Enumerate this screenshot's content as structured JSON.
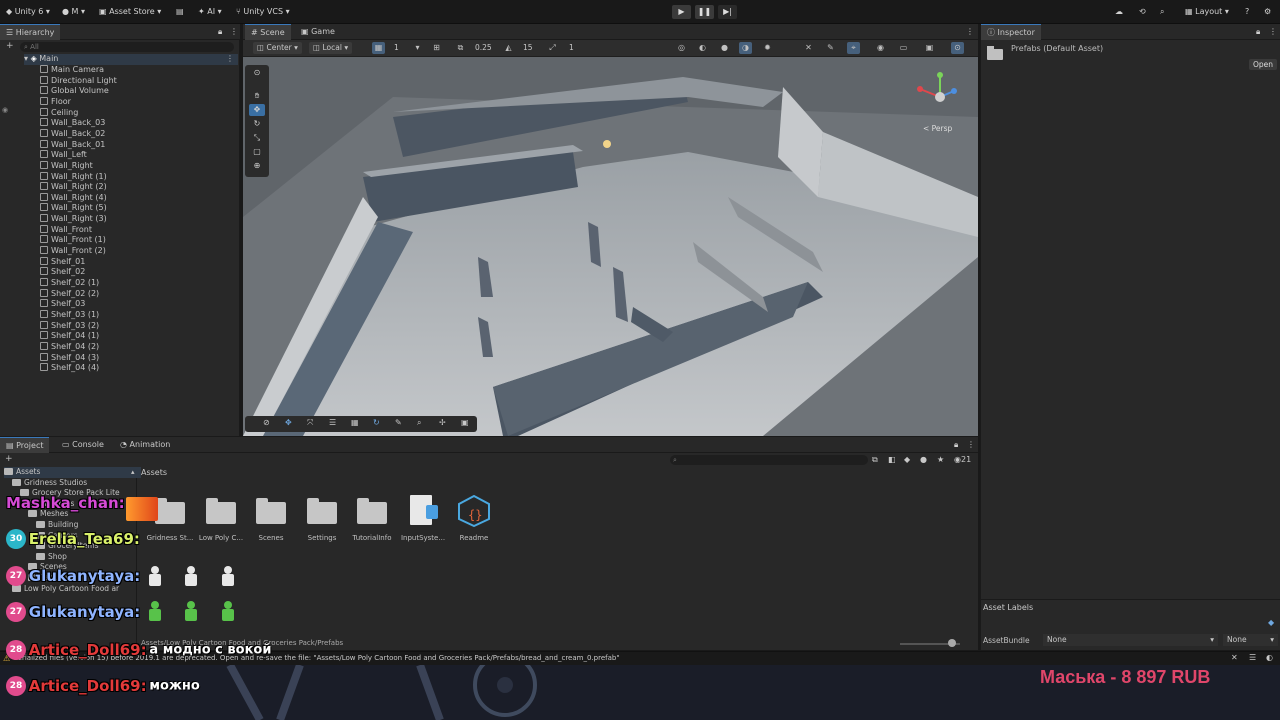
{
  "toolbar": {
    "account": "Unity 6",
    "user": "M",
    "asset_store": "Asset Store",
    "ai": "AI",
    "vcs": "Unity VCS",
    "layout": "Layout"
  },
  "hierarchy": {
    "tab": "Hierarchy",
    "search_placeholder": "All",
    "scene": "Main",
    "items": [
      "Main Camera",
      "Directional Light",
      "Global Volume",
      "Floor",
      "Ceiling",
      "Wall_Back_03",
      "Wall_Back_02",
      "Wall_Back_01",
      "Wall_Left",
      "Wall_Right",
      "Wall_Right (1)",
      "Wall_Right (2)",
      "Wall_Right (4)",
      "Wall_Right (5)",
      "Wall_Right (3)",
      "Wall_Front",
      "Wall_Front (1)",
      "Wall_Front (2)",
      "Shelf_01",
      "Shelf_02",
      "Shelf_02 (1)",
      "Shelf_02 (2)",
      "Shelf_03",
      "Shelf_03 (1)",
      "Shelf_03 (2)",
      "Shelf_04 (1)",
      "Shelf_04 (2)",
      "Shelf_04 (3)",
      "Shelf_04 (4)"
    ]
  },
  "scene": {
    "tab_scene": "Scene",
    "tab_game": "Game",
    "pivot": "Center",
    "space": "Local",
    "grid_value": "1",
    "snap_value": "0.25",
    "rotate_snap": "15",
    "scale_snap": "1",
    "persp_label": "< Persp"
  },
  "inspector": {
    "tab": "Inspector",
    "title": "Prefabs (Default Asset)",
    "open_button": "Open",
    "asset_labels": "Asset Labels",
    "asset_bundle_label": "AssetBundle",
    "asset_bundle_value": "None",
    "variant_value": "None"
  },
  "project": {
    "tab_project": "Project",
    "tab_console": "Console",
    "tab_animation": "Animation",
    "breadcrumb": "Assets",
    "count": "21",
    "tree": [
      {
        "label": "Assets",
        "indent": 0
      },
      {
        "label": "Gridness Studios",
        "indent": 1
      },
      {
        "label": "Grocery Store Pack Lite",
        "indent": 2
      },
      {
        "label": "Materials",
        "indent": 3
      },
      {
        "label": "Meshes",
        "indent": 3
      },
      {
        "label": "Building",
        "indent": 4
      },
      {
        "label": "Carriers",
        "indent": 4
      },
      {
        "label": "GroceryItems",
        "indent": 4
      },
      {
        "label": "Shop",
        "indent": 4
      },
      {
        "label": "Scenes",
        "indent": 3
      },
      {
        "label": "Textures",
        "indent": 3
      },
      {
        "label": "Low Poly Cartoon Food ar",
        "indent": 1
      }
    ],
    "assets": [
      {
        "label": "Gridness St...",
        "kind": "folder"
      },
      {
        "label": "Low Poly C...",
        "kind": "folder"
      },
      {
        "label": "Scenes",
        "kind": "folder"
      },
      {
        "label": "Settings",
        "kind": "folder"
      },
      {
        "label": "TutorialInfo",
        "kind": "folder"
      },
      {
        "label": "InputSyste...",
        "kind": "input"
      },
      {
        "label": "Readme",
        "kind": "readme"
      }
    ],
    "path": "Assets/Low Poly Cartoon Food and Groceries Pack/Prefabs"
  },
  "status": {
    "message": "serialized files (version 15) before 2019.1 are deprecated. Open and re-save the file: \"Assets/Low Poly Cartoon Food and Groceries Pack/Prefabs/bread_and_cream_0.prefab\""
  },
  "stream": {
    "chat": [
      {
        "badge": "",
        "nick": "Mashka_chan:",
        "msg": "",
        "color": "#d64bd6"
      },
      {
        "badge": "30",
        "nick": "Erelia_Tea69:",
        "msg": "",
        "color": "#d9f06a",
        "badge_color": "#2bb6c9"
      },
      {
        "badge": "27",
        "nick": "Glukanytaya:",
        "msg": "",
        "color": "#8fb4ff"
      },
      {
        "badge": "27",
        "nick": "Glukanytaya:",
        "msg": "",
        "color": "#8fb4ff"
      },
      {
        "badge": "28",
        "nick": "Artice_Doll69:",
        "msg": "а модно с вокой",
        "color": "#e33a3a"
      },
      {
        "badge": "28",
        "nick": "Artice_Doll69:",
        "msg": "можно",
        "color": "#e33a3a"
      }
    ],
    "donation": "Маська - 8 897 RUB"
  },
  "colors": {
    "accent": "#3a79bb",
    "panel": "#282828",
    "donation": "#e0466a"
  }
}
